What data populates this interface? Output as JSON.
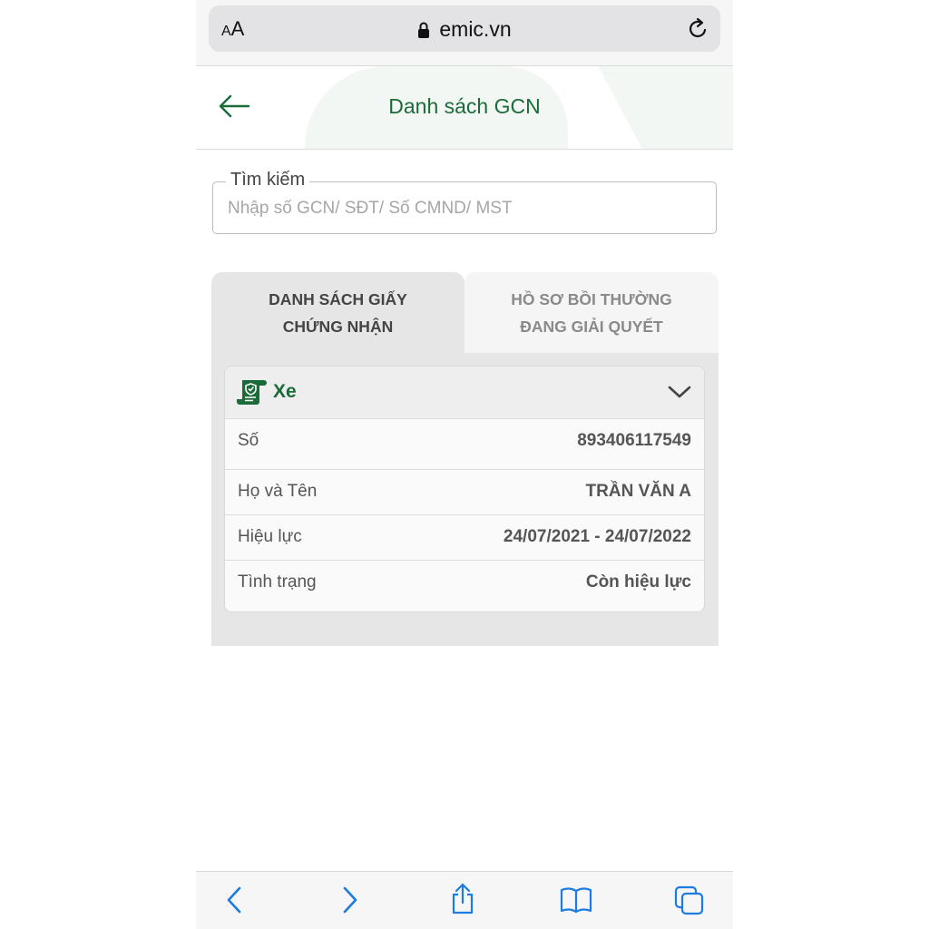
{
  "browser": {
    "aa_small": "A",
    "aa_large": "A",
    "url": "emic.vn"
  },
  "header": {
    "title": "Danh sách GCN"
  },
  "search": {
    "label": "Tìm kiếm",
    "placeholder": "Nhập số GCN/ SĐT/ Số CMND/ MST",
    "value": ""
  },
  "tabs": [
    {
      "line1": "DANH SÁCH GIẤY",
      "line2": "CHỨNG NHẬN",
      "active": true
    },
    {
      "line1": "HỒ SƠ BỒI THƯỜNG",
      "line2": "ĐANG GIẢI QUYẾT",
      "active": false
    }
  ],
  "card": {
    "title": "Xe",
    "rows": [
      {
        "label": "Số",
        "value": "893406117549"
      },
      {
        "label": "Họ và Tên",
        "value": "TRẦN VĂN A"
      },
      {
        "label": "Hiệu lực",
        "value": "24/07/2021 - 24/07/2022"
      },
      {
        "label": "Tình trạng",
        "value": "Còn hiệu lực"
      }
    ]
  },
  "colors": {
    "brand_green": "#1b6b3a",
    "ios_blue": "#1c7ce0"
  },
  "icons": {
    "back": "arrow-left-icon",
    "lock": "lock-icon",
    "reload": "reload-icon",
    "certificate": "certificate-icon",
    "chevron": "chevron-down-icon",
    "toolbar": [
      "chevron-left-icon",
      "chevron-right-icon",
      "share-icon",
      "book-icon",
      "tabs-icon"
    ]
  }
}
